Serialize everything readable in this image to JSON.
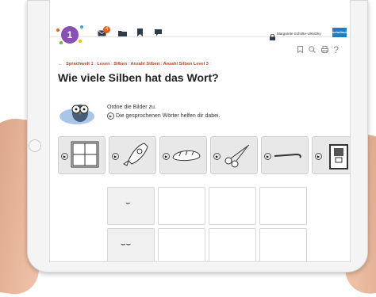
{
  "topbar": {
    "logo_number": "1",
    "mail_badge": "4",
    "user_name": "Margarete Schütte-Ulmitzky",
    "brand_label": "schulbuch",
    "icons": [
      "mail-icon",
      "folder-icon",
      "bookmark-icon",
      "chat-icon",
      "lock-icon"
    ]
  },
  "tools": {
    "icons": [
      "bookmark-outline-icon",
      "search-icon",
      "print-icon",
      "help-icon"
    ],
    "help_label": "?"
  },
  "breadcrumb": {
    "back_icon": "arrow-left-icon",
    "items": [
      "Sprachwelt 1",
      "Lesen",
      "Silben",
      "Anzahl Silben",
      "Anzahl Silben Level 3"
    ],
    "separator": ":"
  },
  "page": {
    "title": "Wie viele Silben hat das Wort?"
  },
  "instructions": {
    "line1": "Ordne die Bilder zu.",
    "line2": "Die gesprochenen Wörter helfen dir dabei."
  },
  "cards": [
    {
      "name": "window",
      "icon": "window-icon"
    },
    {
      "name": "rocket",
      "icon": "rocket-icon"
    },
    {
      "name": "bread",
      "icon": "bread-icon"
    },
    {
      "name": "scissors",
      "icon": "scissors-icon"
    },
    {
      "name": "cane",
      "icon": "cane-icon"
    },
    {
      "name": "toaster",
      "icon": "toaster-icon"
    }
  ],
  "grid": {
    "rows": [
      {
        "syllable_mark": "⌣"
      },
      {
        "syllable_mark": "⌣⌣"
      }
    ]
  },
  "colors": {
    "accent": "#c0442a",
    "logo": "#8a4fb5",
    "badge": "#e3621b",
    "brand": "#1c7fc4"
  }
}
